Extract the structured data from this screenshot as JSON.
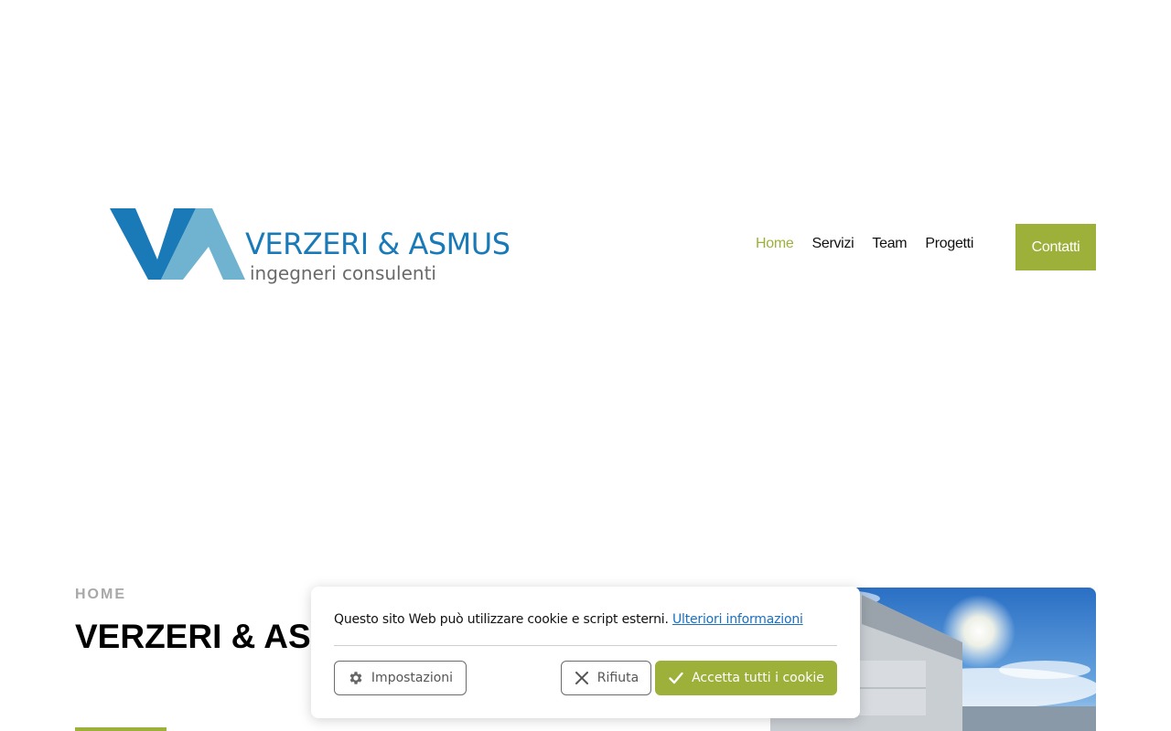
{
  "brand": {
    "name": "VERZERI & ASMUS",
    "tagline": "ingegneri consulenti"
  },
  "nav": {
    "items": [
      {
        "label": "Home",
        "active": true
      },
      {
        "label": "Servizi",
        "active": false
      },
      {
        "label": "Team",
        "active": false
      },
      {
        "label": "Progetti",
        "active": false
      }
    ],
    "contact_label": "Contatti"
  },
  "hero": {
    "breadcrumb": "HOME",
    "title": "VERZERI & ASMUS ingegneri consulenti"
  },
  "cookie": {
    "text": "Questo sito Web può utilizzare cookie e script esterni.",
    "link": "Ulteriori informazioni",
    "settings_label": "Impostazioni",
    "reject_label": "Rifiuta",
    "accept_label": "Accetta tutti i cookie"
  },
  "colors": {
    "accent": "#9cb03a",
    "brand_blue": "#1a7ab8",
    "brand_light_blue": "#6fb3d1"
  },
  "icons": {
    "settings": "gear-icon",
    "reject": "close-icon",
    "accept": "check-icon"
  }
}
